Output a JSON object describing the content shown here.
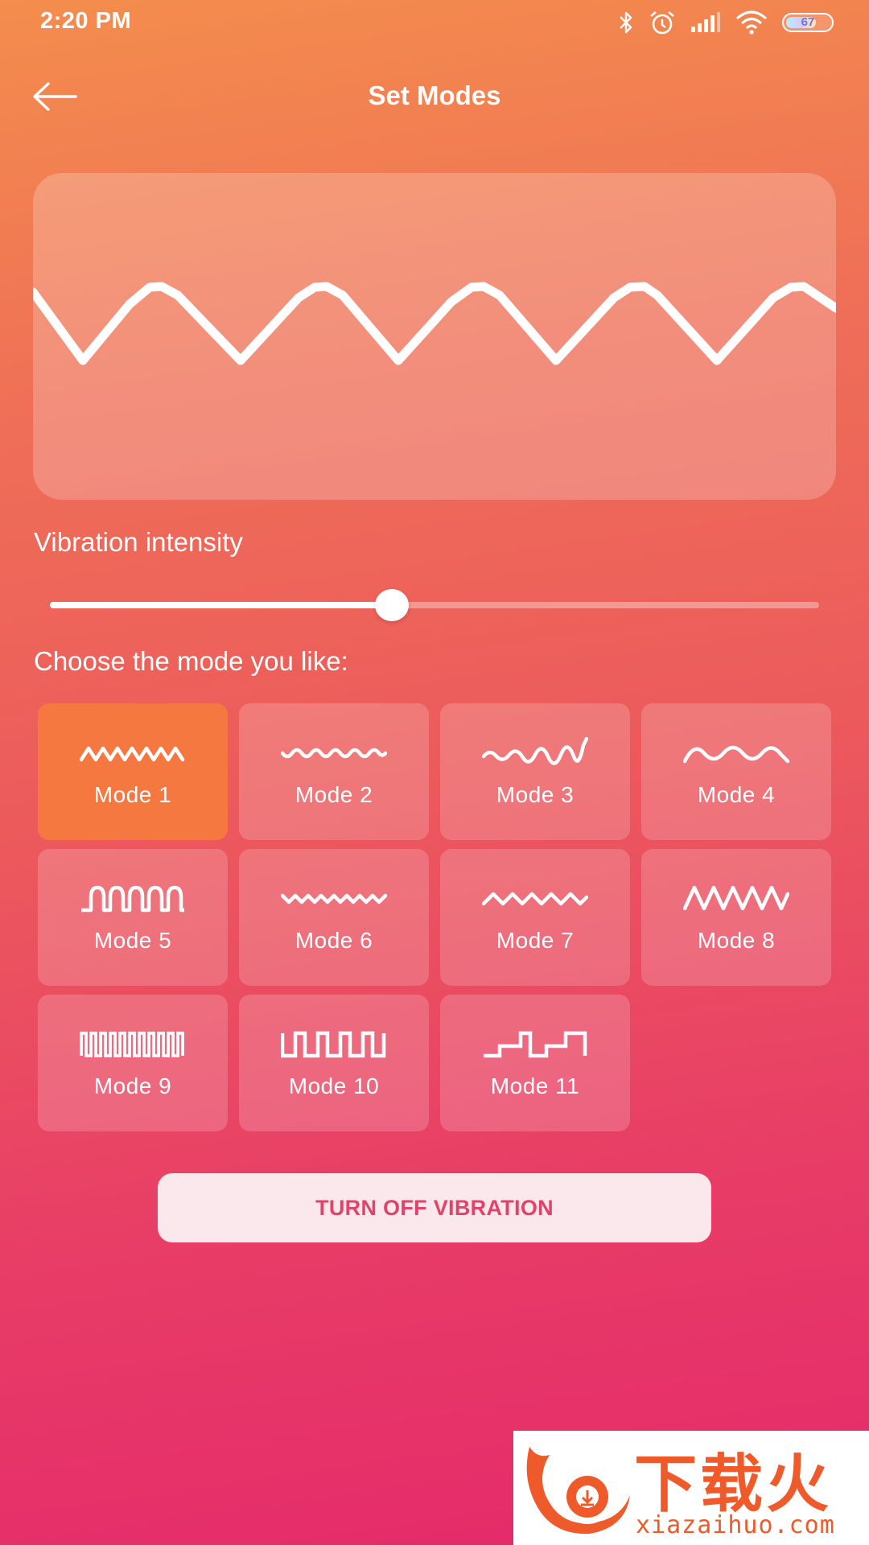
{
  "status_bar": {
    "time": "2:20 PM",
    "battery_level": "67",
    "icons": [
      "bluetooth-icon",
      "alarm-icon",
      "signal-icon",
      "wifi-icon",
      "battery-icon"
    ]
  },
  "header": {
    "title": "Set Modes",
    "back_icon": "arrow-left-icon"
  },
  "intensity": {
    "label": "Vibration intensity",
    "value_fraction": 0.445
  },
  "modes": {
    "prompt": "Choose the mode you like:",
    "selected_index": 0,
    "items": [
      {
        "label": "Mode 1",
        "icon": "dense-wave-icon"
      },
      {
        "label": "Mode 2",
        "icon": "small-wave-icon"
      },
      {
        "label": "Mode 3",
        "icon": "growing-wave-icon"
      },
      {
        "label": "Mode 4",
        "icon": "smooth-wave-icon"
      },
      {
        "label": "Mode 5",
        "icon": "pulse-arch-icon"
      },
      {
        "label": "Mode 6",
        "icon": "small-zigzag-icon"
      },
      {
        "label": "Mode 7",
        "icon": "zigzag-icon"
      },
      {
        "label": "Mode 8",
        "icon": "large-zigzag-icon"
      },
      {
        "label": "Mode 9",
        "icon": "dense-square-wave-icon"
      },
      {
        "label": "Mode 10",
        "icon": "square-wave-icon"
      },
      {
        "label": "Mode 11",
        "icon": "step-wave-icon"
      }
    ]
  },
  "turn_off_button": {
    "label": "TURN OFF VIBRATION"
  },
  "watermark": {
    "brand": "下载火",
    "url": "xiazaihuo.com"
  },
  "colors": {
    "gradient_top": "#f48d4d",
    "gradient_bottom": "#e4296b",
    "active_tile": "#f57840",
    "button_text": "#e0436a",
    "watermark": "#ef5a2a"
  }
}
